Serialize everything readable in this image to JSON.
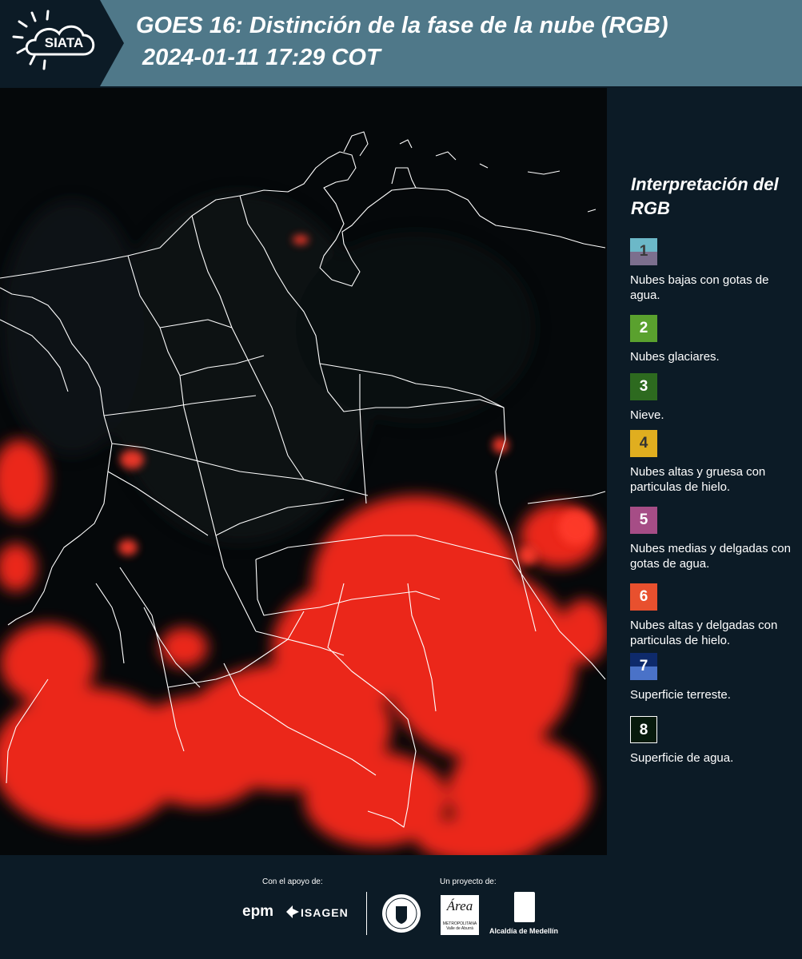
{
  "header": {
    "logo_text": "SIATA",
    "title_line1": "GOES 16: Distinción de la fase de la nube (RGB)",
    "title_line2": "2024-01-11 17:29 COT"
  },
  "legend": {
    "title": "Interpretación del RGB",
    "items": [
      {
        "number": "1",
        "top_color": "#6cb8c8",
        "bottom_color": "#7c6f8e",
        "number_color": "#3a3a3a",
        "label": "Nubes bajas con gotas de agua."
      },
      {
        "number": "2",
        "top_color": "#5aa12e",
        "bottom_color": "#5aa12e",
        "number_color": "#ffffff",
        "label": "Nubes glaciares."
      },
      {
        "number": "3",
        "top_color": "#2d6a1f",
        "bottom_color": "#2d6a1f",
        "number_color": "#ffffff",
        "label": "Nieve."
      },
      {
        "number": "4",
        "top_color": "#e0ae1f",
        "bottom_color": "#e0ae1f",
        "number_color": "#333333",
        "label": "Nubes altas y gruesa con particulas de hielo."
      },
      {
        "number": "5",
        "top_color": "#a64d86",
        "bottom_color": "#a64d86",
        "number_color": "#ffffff",
        "label": "Nubes medias y delgadas con gotas de agua."
      },
      {
        "number": "6",
        "top_color": "#e8502e",
        "bottom_color": "#e8502e",
        "number_color": "#ffffff",
        "label": "Nubes altas y delgadas con particulas de hielo."
      },
      {
        "number": "7",
        "top_color": "#0e2a6b",
        "bottom_color": "#4a72c8",
        "number_color": "#ffffff",
        "label": "Superficie terreste."
      },
      {
        "number": "8",
        "top_color": "#071a0c",
        "bottom_color": "#071a0c",
        "number_color": "#ffffff",
        "label": "Superficie de agua."
      }
    ]
  },
  "footer": {
    "support_label": "Con el apoyo de:",
    "project_label": "Un proyecto de:",
    "sponsor_epm": "epm",
    "sponsor_isagen": "ISAGEN",
    "area_logo_text": "Área",
    "area_logo_sub": "METROPOLITANA Valle de Aburrá",
    "alcaldia_label": "Alcaldía de Medellín"
  },
  "colors": {
    "header_bg": "#4f7889",
    "panel_bg": "#0c1b26",
    "cloud_red": "#ff2a1c",
    "border_line": "#ffffff"
  }
}
